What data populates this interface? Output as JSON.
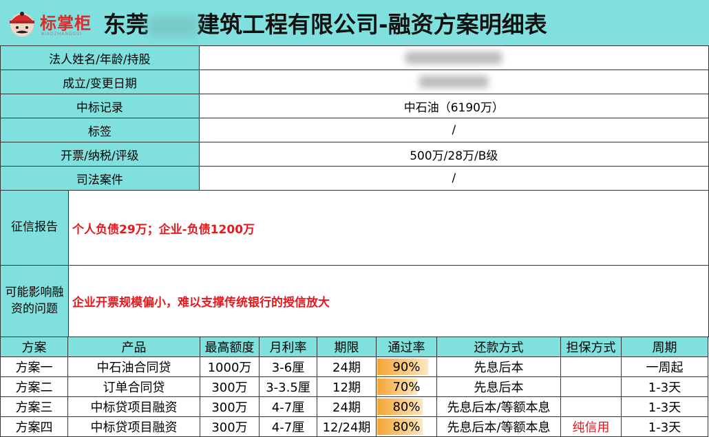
{
  "header": {
    "logo_text": "标掌柜",
    "logo_sub": "BIAOZHANGGUI",
    "title_prefix": "东莞",
    "title_suffix": "建筑工程有限公司-融资方案明细表"
  },
  "info_rows": [
    {
      "label": "法人姓名/年龄/持股",
      "value": ""
    },
    {
      "label": "成立/变更日期",
      "value": ""
    },
    {
      "label": "中标记录",
      "value": "中石油（6190万）"
    },
    {
      "label": "标签",
      "value": "/"
    },
    {
      "label": "开票/纳税/评级",
      "value": "500万/28万/B级"
    },
    {
      "label": "司法案件",
      "value": "/"
    }
  ],
  "credit": {
    "label": "征信报告",
    "value": "个人负债29万；企业-负债1200万"
  },
  "issues": {
    "label": "可能影响融资的问题",
    "value": "企业开票规模偏小，难以支撑传统银行的授信放大"
  },
  "plans": {
    "headers": [
      "方案",
      "产品",
      "最高额度",
      "月利率",
      "期限",
      "通过率",
      "还款方式",
      "担保方式",
      "周期"
    ],
    "rows": [
      {
        "name": "方案一",
        "product": "中石油合同贷",
        "limit": "1000万",
        "rate": "3-6厘",
        "term": "24期",
        "pass": "90%",
        "pass_value": 90,
        "repay": "先息后本",
        "guarantee": "",
        "cycle": "一周起"
      },
      {
        "name": "方案二",
        "product": "订单合同贷",
        "limit": "300万",
        "rate": "3-3.5厘",
        "term": "12期",
        "pass": "70%",
        "pass_value": 70,
        "repay": "先息后本",
        "guarantee": "",
        "cycle": "1-3天"
      },
      {
        "name": "方案三",
        "product": "中标贷项目融资",
        "limit": "300万",
        "rate": "4-7厘",
        "term": "24期",
        "pass": "80%",
        "pass_value": 80,
        "repay": "先息后本/等额本息",
        "guarantee": "",
        "cycle": "1-3天"
      },
      {
        "name": "方案四",
        "product": "中标贷项目融资",
        "limit": "300万",
        "rate": "4-7厘",
        "term": "12/24期",
        "pass": "80%",
        "pass_value": 80,
        "repay": "先息后本/等额本息",
        "guarantee": "纯信用",
        "cycle": "1-3天"
      }
    ]
  },
  "colors": {
    "header_bg": "#7fe0dd",
    "highlight_red": "#e8171c",
    "bar_orange": "#f4a535"
  }
}
